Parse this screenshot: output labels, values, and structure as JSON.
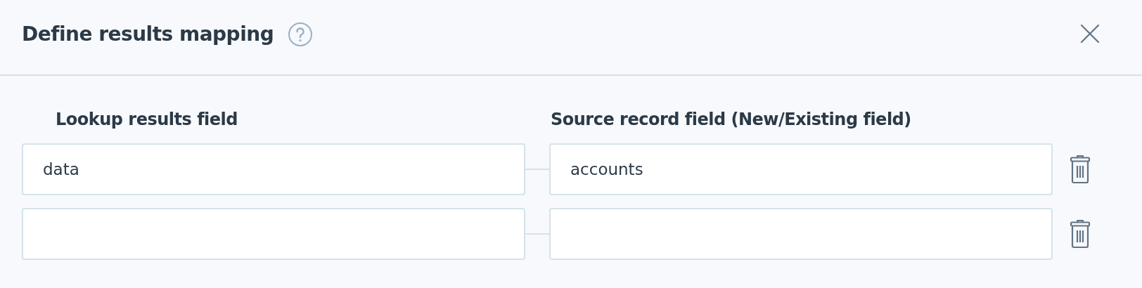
{
  "dialog": {
    "title": "Define results mapping"
  },
  "columns": [
    "Lookup results field",
    "Source record field (New/Existing field)"
  ],
  "rows": [
    {
      "lookup_field": "data",
      "source_field": "accounts"
    },
    {}
  ]
}
